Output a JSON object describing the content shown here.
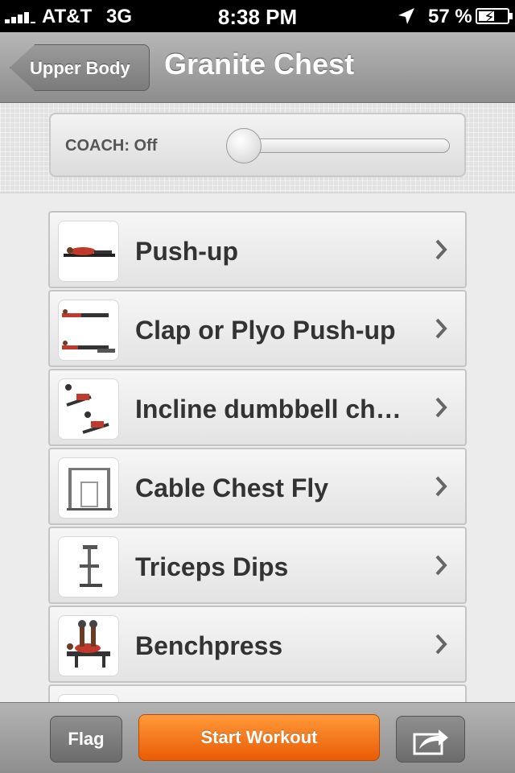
{
  "status_bar": {
    "carrier": "AT&T",
    "network": "3G",
    "time": "8:38 PM",
    "battery": "57 %",
    "battery_level": 0.57
  },
  "nav": {
    "back_label": "Upper Body",
    "title": "Granite Chest"
  },
  "coach": {
    "label": "COACH: Off",
    "value": 0
  },
  "exercises": [
    {
      "label": "Push-up",
      "icon": "push-up-thumbnail"
    },
    {
      "label": "Clap or Plyo Push-up",
      "icon": "plyo-push-up-thumbnail"
    },
    {
      "label": "Incline dumbbell ch…",
      "icon": "incline-dumbbell-thumbnail"
    },
    {
      "label": "Cable Chest Fly",
      "icon": "cable-machine-thumbnail"
    },
    {
      "label": "Triceps Dips",
      "icon": "dip-station-thumbnail"
    },
    {
      "label": "Benchpress",
      "icon": "benchpress-thumbnail"
    },
    {
      "label": "",
      "icon": "partial-row-thumbnail"
    }
  ],
  "toolbar": {
    "flag_label": "Flag",
    "start_label": "Start Workout",
    "share_icon": "share-icon"
  },
  "colors": {
    "accent_orange": "#f07516",
    "nav_gray": "#a3a3a3"
  }
}
